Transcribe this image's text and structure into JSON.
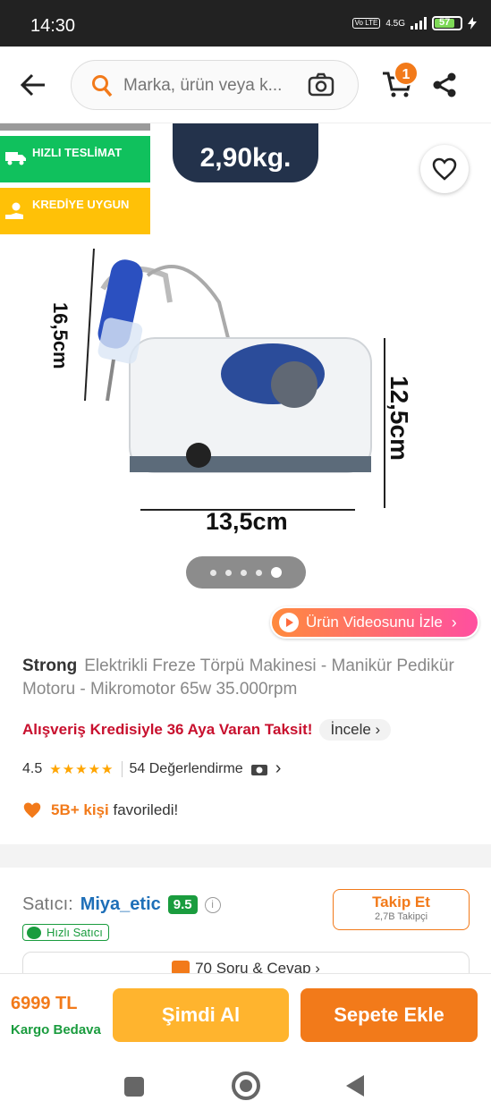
{
  "status_bar": {
    "time": "14:30",
    "network": "4.5G",
    "volte": "Vo LTE",
    "battery": "57"
  },
  "header": {
    "search_placeholder": "Marka, ürün veya k...",
    "cart_count": "1"
  },
  "gallery": {
    "tags": [
      {
        "label": "HIZLI TESLİMAT"
      },
      {
        "label": "KREDİYE UYGUN"
      }
    ],
    "weight_label": "2,90kg.",
    "dimensions": {
      "height": "16,5cm",
      "depth": "12,5cm",
      "width": "13,5cm"
    },
    "page_count": 5,
    "active_page": 5,
    "video_button": "Ürün Videosunu İzle"
  },
  "product": {
    "brand": "Strong",
    "name": "Elektrikli Freze Törpü Makinesi - Manikür Pedikür Motoru - Mikromotor 65w 35.000rpm",
    "credit_text": "Alışveriş Kredisiyle 36 Aya Varan Taksit!",
    "credit_link": "İncele",
    "rating": "4.5",
    "stars": "★★★★★",
    "reviews": "54 Değerlendirme",
    "favorites_count": "5B+ kişi",
    "favorites_text": "favoriledi!"
  },
  "seller": {
    "label": "Satıcı:",
    "name": "Miya_etic",
    "score": "9.5",
    "badge": "Hızlı Satıcı",
    "follow": "Takip Et",
    "followers": "2,7B Takipçi",
    "qa": "70 Soru & Cevap"
  },
  "bottom": {
    "price": "6999 TL",
    "shipping": "Kargo Bedava",
    "buy_now": "Şimdi Al",
    "add_to_cart": "Sepete Ekle"
  },
  "colors": {
    "accent": "#f27a1a",
    "green": "#10c15d",
    "yellow": "#ffc107",
    "credit_red": "#c8102e"
  }
}
